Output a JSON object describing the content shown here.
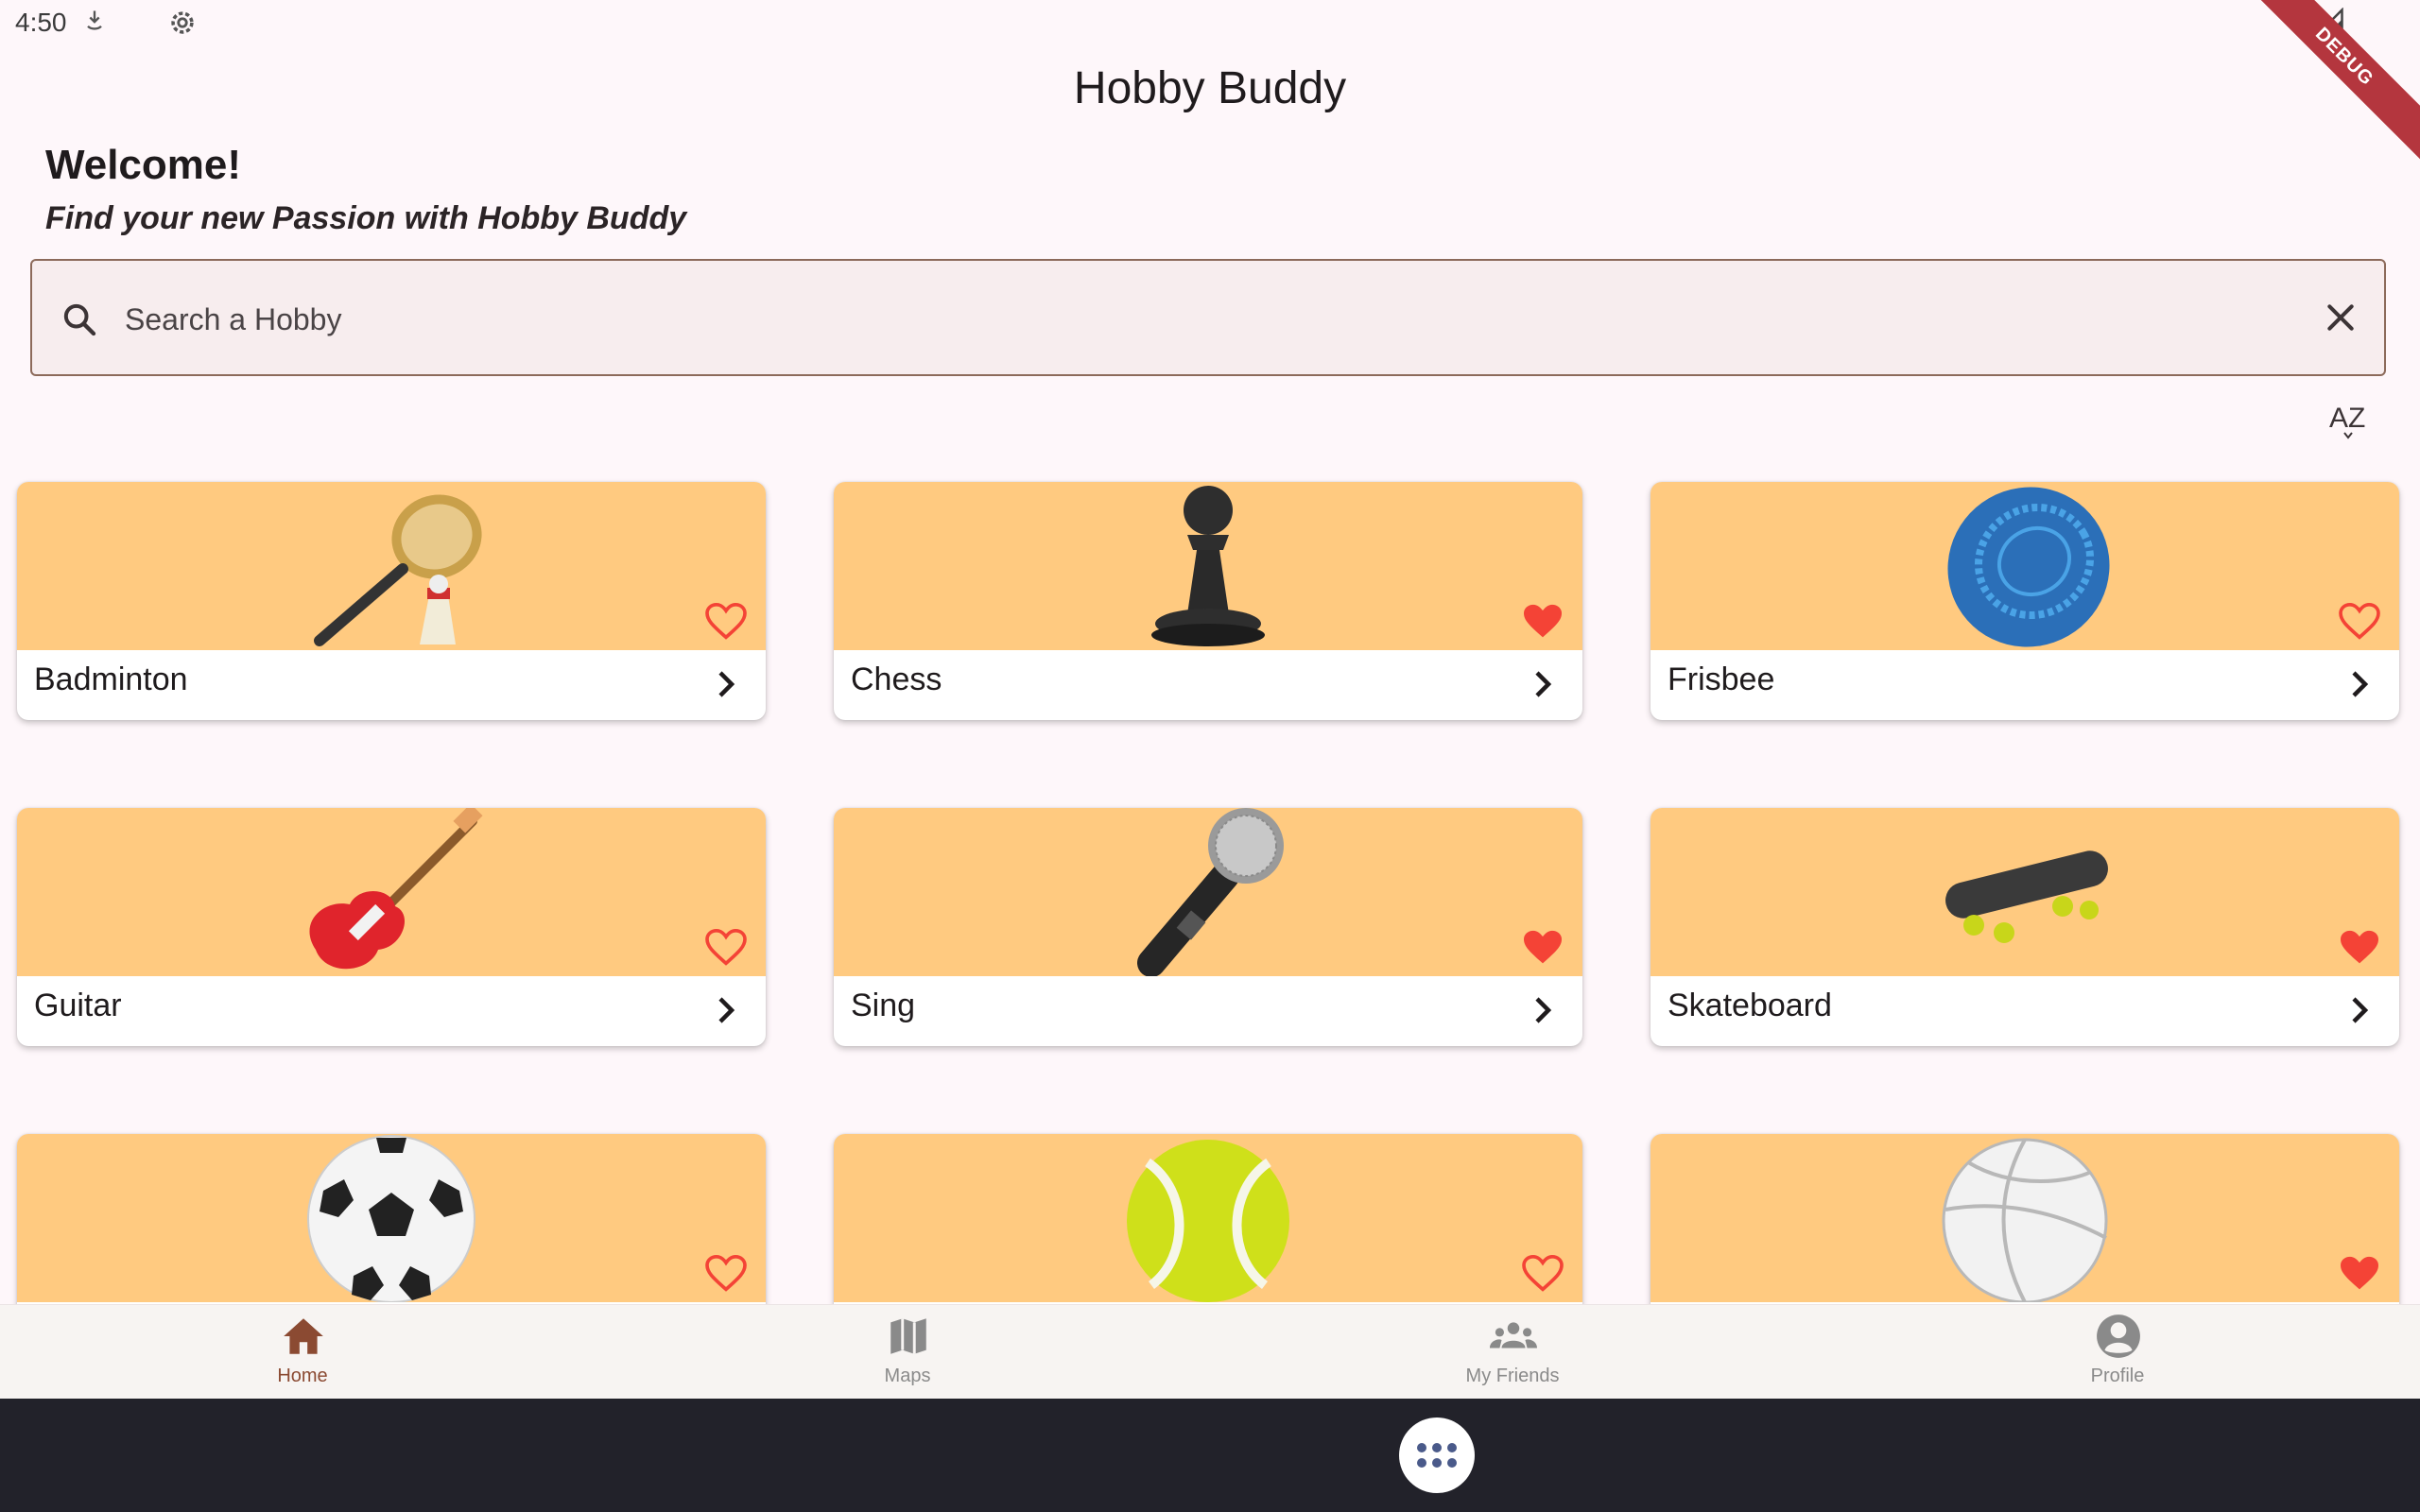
{
  "status_bar": {
    "time": "4:50"
  },
  "debug_banner": "DEBUG",
  "app_bar": {
    "title": "Hobby Buddy"
  },
  "header": {
    "welcome": "Welcome!",
    "tagline": "Find your new Passion with Hobby Buddy"
  },
  "search": {
    "placeholder": "Search a Hobby",
    "value": ""
  },
  "sort": {
    "label": "AZ"
  },
  "colors": {
    "card_image_bg": "#ffca80",
    "favorite": "#f44336",
    "accent": "#8b4a32",
    "background": "#fef7fa"
  },
  "hobbies": [
    {
      "name": "Badminton",
      "icon": "badminton-icon",
      "favorite": false
    },
    {
      "name": "Chess",
      "icon": "chess-pawn-icon",
      "favorite": true
    },
    {
      "name": "Frisbee",
      "icon": "frisbee-icon",
      "favorite": false
    },
    {
      "name": "Guitar",
      "icon": "guitar-icon",
      "favorite": false
    },
    {
      "name": "Sing",
      "icon": "microphone-icon",
      "favorite": true
    },
    {
      "name": "Skateboard",
      "icon": "skateboard-icon",
      "favorite": true
    },
    {
      "name": "",
      "icon": "soccer-ball-icon",
      "favorite": false
    },
    {
      "name": "",
      "icon": "tennis-ball-icon",
      "favorite": false
    },
    {
      "name": "",
      "icon": "volleyball-icon",
      "favorite": true
    }
  ],
  "nav": {
    "items": [
      {
        "label": "Home",
        "icon": "home-icon",
        "active": true
      },
      {
        "label": "Maps",
        "icon": "map-icon",
        "active": false
      },
      {
        "label": "My Friends",
        "icon": "group-icon",
        "active": false
      },
      {
        "label": "Profile",
        "icon": "account-circle-icon",
        "active": false
      }
    ]
  }
}
